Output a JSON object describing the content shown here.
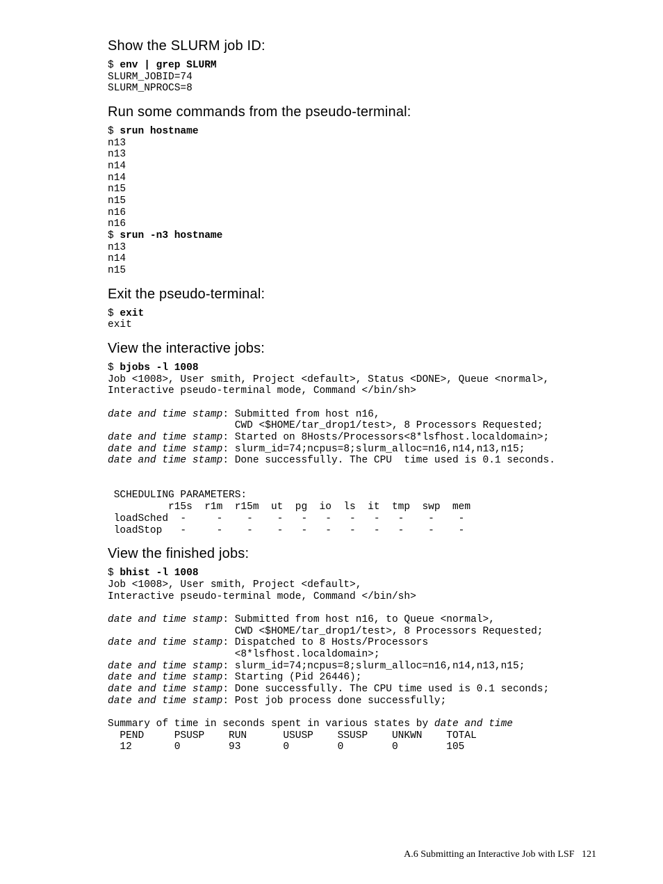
{
  "headings": {
    "h1": "Show the SLURM job ID:",
    "h2": "Run some commands from the pseudo-terminal:",
    "h3": "Exit the pseudo-terminal:",
    "h4": "View the interactive jobs:",
    "h5": "View the finished jobs:"
  },
  "blocks": {
    "env_cmd": "env | grep SLURM",
    "env_out": "SLURM_JOBID=74\nSLURM_NPROCS=8",
    "srun1_cmd": "srun hostname",
    "srun1_out": "n13\nn13\nn14\nn14\nn15\nn15\nn16\nn16",
    "srun2_cmd": "srun -n3 hostname",
    "srun2_out": "n13\nn14\nn15",
    "exit_cmd": "exit",
    "exit_out": "exit",
    "bjobs_cmd": "bjobs -l 1008",
    "bjobs_out1": "Job <1008>, User smith, Project <default>, Status <DONE>, Queue <normal>,\nInteractive pseudo-terminal mode, Command </bin/sh>",
    "dt": "date and time stamp",
    "bjobs_l1_tail": ": Submitted from host n16,",
    "bjobs_l1b": "                     CWD <$HOME/tar_drop1/test>, 8 Processors Requested;",
    "bjobs_l2_tail": ": Started on 8Hosts/Processors<8*lsfhost.localdomain>;",
    "bjobs_l3_tail": ": slurm_id=74;ncpus=8;slurm_alloc=n16,n14,n13,n15;",
    "bjobs_l4_tail": ": Done successfully. The CPU  time used is 0.1 seconds.",
    "sched_hdr": " SCHEDULING PARAMETERS:",
    "sched_cols": "          r15s  r1m  r15m  ut  pg  io  ls  it  tmp  swp  mem",
    "sched_r1": " loadSched  -     -    -    -   -   -   -   -   -    -    -",
    "sched_r2": " loadStop   -     -    -    -   -   -   -   -   -    -    -",
    "bhist_cmd": "bhist -l 1008",
    "bhist_out1": "Job <1008>, User smith, Project <default>,\nInteractive pseudo-terminal mode, Command </bin/sh>",
    "bhist_l1_tail": ": Submitted from host n16, to Queue <normal>,",
    "bhist_l1b": "                     CWD <$HOME/tar_drop1/test>, 8 Processors Requested;",
    "bhist_l2_tail": ": Dispatched to 8 Hosts/Processors",
    "bhist_l2b": "                     <8*lsfhost.localdomain>;",
    "bhist_l3_tail": ": slurm_id=74;ncpus=8;slurm_alloc=n16,n14,n13,n15;",
    "bhist_l4_tail": ": Starting (Pid 26446);",
    "bhist_l5_tail": ": Done successfully. The CPU time used is 0.1 seconds;",
    "bhist_l6_tail": ": Post job process done successfully;",
    "summary_pre": "Summary of time in seconds spent in various states by ",
    "summary_ital": "date and time",
    "summary_cols": "  PEND     PSUSP    RUN      USUSP    SSUSP    UNKWN    TOTAL",
    "summary_vals": "  12       0        93       0        0        0        105"
  },
  "footer": {
    "section": "A.6 Submitting an Interactive Job with LSF",
    "page": "121"
  }
}
